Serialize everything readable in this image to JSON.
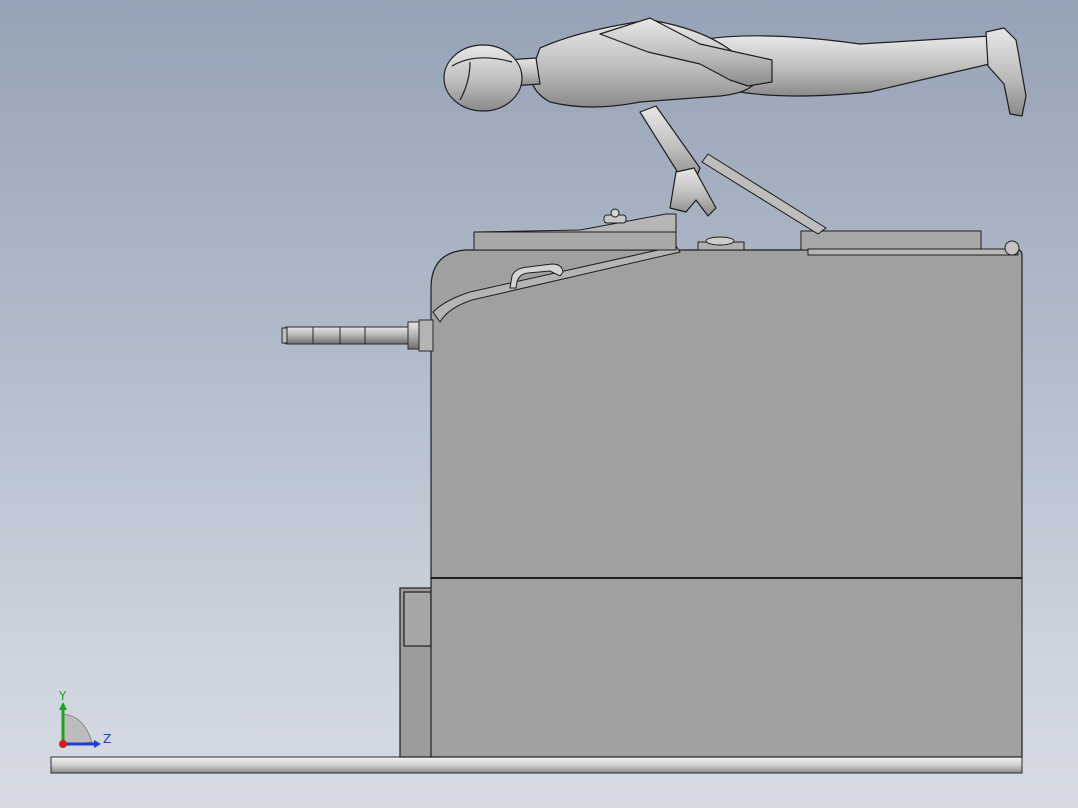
{
  "viewport": {
    "background_top": "#96a3b6",
    "background_bottom": "#d6dbe4"
  },
  "triad": {
    "y_label": "Y",
    "z_label": "Z",
    "y_color": "#1aa51a",
    "z_color": "#1f3fd0",
    "x_color": "#d21f1f"
  },
  "model": {
    "body_color": "#a0a0a0",
    "edge_color": "#1e1e1e",
    "figure_color": "#bdbdbd"
  }
}
